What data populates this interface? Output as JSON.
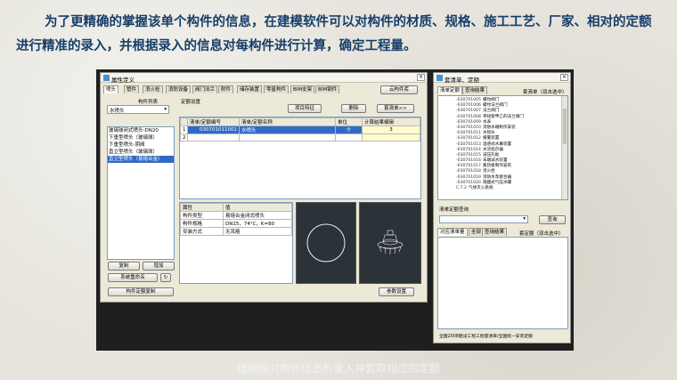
{
  "slide": {
    "text": "为了更精确的掌握该单个构件的信息，在建模软件可以对构件的材质、规格、施工工艺、厂家、相对的定额进行精准的录入，并根据录入的信息对每构件进行计算，确定工程量。",
    "caption": "建模端对构件信息的录入并套取相应的定额"
  },
  "attr_window": {
    "title": "属性定义",
    "tabs": [
      "喷头",
      "管件",
      "消火栓",
      "消防设备",
      "阀门法兰",
      "附件",
      "储存装置",
      "零星构件",
      "BIM支架",
      "BIM钢件"
    ],
    "right_top_button": "云构件库",
    "left": {
      "header": "构件列表",
      "dropdown_value": "水喷头",
      "items": [
        "玻璃球闭式喷头-DN20",
        "下垂型喷头（玻璃球）",
        "下垂型喷头-阴阀",
        "直立型喷头（玻璃球）",
        "直立型喷头（易熔合金）"
      ],
      "selected_index": 4,
      "buttons": {
        "copy": "复制",
        "add": "增加",
        "rename": "系统重命名",
        "batch": "构件定额复制"
      }
    },
    "quota": {
      "header": "定额设置",
      "buttons": {
        "feature": "项目特征",
        "delete": "删除",
        "set": "套清单>>"
      },
      "columns": [
        "",
        "清单/定额编号",
        "清单/定额名称",
        "单位",
        "计算结果编辑"
      ],
      "rows": [
        {
          "num": "1",
          "code": "030701011001",
          "name": "水喷头",
          "unit": "个",
          "calc": "3"
        },
        {
          "num": "2",
          "code": "",
          "name": "",
          "unit": "",
          "calc": ""
        }
      ]
    },
    "props": {
      "columns": [
        "属性",
        "值"
      ],
      "rows": [
        {
          "name": "构件类型",
          "value": "易熔合金闭式喷头"
        },
        {
          "name": "构件规格",
          "value": "DN15，74°C，K=80"
        },
        {
          "name": "安装方式",
          "value": "无吊筋"
        }
      ]
    },
    "bottom_button": "参数设置"
  },
  "quota_window": {
    "title": "套清单、定额",
    "tabs_top": [
      "清单定额",
      "查询结果"
    ],
    "scope_label": "套清单（双击选中）",
    "tree": [
      {
        "code": "-030701005",
        "name": "螺纹阀门"
      },
      {
        "code": "-030701006",
        "name": "螺纹法兰阀门"
      },
      {
        "code": "-030701007",
        "name": "法兰阀门"
      },
      {
        "code": "-030701008",
        "name": "带短管甲乙的法兰阀门"
      },
      {
        "code": "-030701009",
        "name": "水表"
      },
      {
        "code": "-030701010",
        "name": "消防水箱制作安装"
      },
      {
        "code": "-030701011",
        "name": "水喷头"
      },
      {
        "code": "-030701012",
        "name": "报警装置"
      },
      {
        "code": "-030701013",
        "name": "温感式水幕装置"
      },
      {
        "code": "-030701014",
        "name": "水流指示器"
      },
      {
        "code": "-030701015",
        "name": "减压孔板"
      },
      {
        "code": "-030701016",
        "name": "末端试水装置"
      },
      {
        "code": "-030701017",
        "name": "集热板制作安装"
      },
      {
        "code": "-030701018",
        "name": "消火栓"
      },
      {
        "code": "-030701019",
        "name": "消防水泵接合器"
      },
      {
        "code": "-030701020",
        "name": "隔膜式气压水罐"
      },
      {
        "code": "C.7.2",
        "name": "气体灭火系统"
      }
    ],
    "query_label": "清单定额查询",
    "query_button": "查询",
    "tabs_bottom": [
      "对应清单量",
      "全部",
      "查询结果",
      "套定额（双击选中）"
    ],
    "footer": "全国2008建设工程工程量清单/全国统一安装定额"
  },
  "colors": {
    "title_text": "#173e6a",
    "selection": "#316ac5",
    "dark_view": "#2b3238"
  }
}
